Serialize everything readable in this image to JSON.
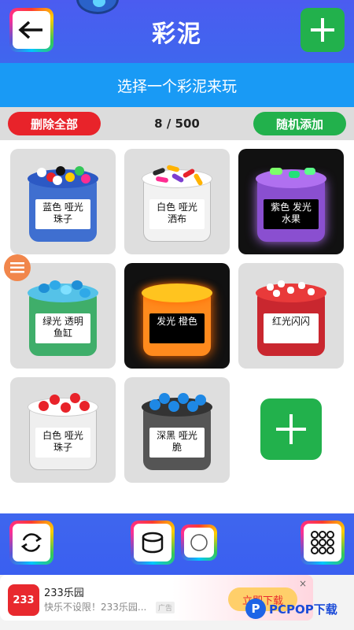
{
  "header": {
    "title": "彩泥",
    "back_icon": "arrow-left-icon",
    "add_icon": "plus-icon"
  },
  "subtitle": "选择一个彩泥来玩",
  "controls": {
    "delete_all": "删除全部",
    "counter": "8 / 500",
    "random_add": "随机添加"
  },
  "slimes": [
    {
      "label": "蓝色 哑光 珠子",
      "jar_color": "#3f6fd0",
      "lid_color": "#2c59c4",
      "label_dark": false,
      "card_dark": false
    },
    {
      "label": "白色 哑光 洒布",
      "jar_color": "#f2f2f2",
      "lid_color": "#ffffff",
      "label_dark": false,
      "card_dark": false
    },
    {
      "label": "紫色 发光 水果",
      "jar_color": "#8a4fd0",
      "lid_color": "#b070f0",
      "label_dark": true,
      "card_dark": true
    },
    {
      "label": "绿光 透明 鱼缸",
      "jar_color": "#3fae6a",
      "lid_color": "#55c2e8",
      "label_dark": false,
      "card_dark": false
    },
    {
      "label": "发光 橙色",
      "jar_color": "#ff8a1d",
      "lid_color": "#ffc41f",
      "label_dark": true,
      "card_dark": true
    },
    {
      "label": "红光闪闪",
      "jar_color": "#c9272f",
      "lid_color": "#e93a3a",
      "label_dark": false,
      "card_dark": false
    },
    {
      "label": "白色 哑光 珠子",
      "jar_color": "#efefef",
      "lid_color": "#ffffff",
      "label_dark": false,
      "card_dark": false
    },
    {
      "label": "深黑 哑光脆",
      "jar_color": "#555555",
      "lid_color": "#1e88e5",
      "label_dark": false,
      "card_dark": false
    }
  ],
  "toolbar": {
    "refresh_icon": "refresh-icon",
    "jar_icon": "jar-icon",
    "circle_icon": "circle-icon",
    "grid_icon": "dots-grid-icon"
  },
  "ad": {
    "logo": "233",
    "title": "233乐园",
    "desc": "快乐不设限！233乐园...",
    "tag": "广告",
    "cta": "立即下载",
    "close": "×"
  },
  "watermark": {
    "logo": "P",
    "text": "PCPOP下载"
  }
}
